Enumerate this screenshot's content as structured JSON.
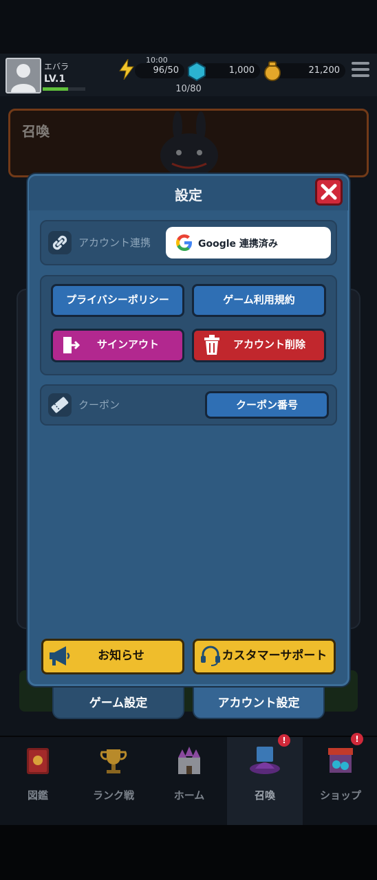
{
  "player": {
    "name": "エバラ",
    "level": "LV.1",
    "xp_progress": 0.6
  },
  "resources": {
    "energy_timer": "10:00",
    "energy": "96/50",
    "gems": "1,000",
    "gold": "21,200",
    "stage_progress": "10/80"
  },
  "background": {
    "summon_title": "召喚"
  },
  "modal": {
    "title": "設定",
    "account_link_label": "アカウント連携",
    "google_button": "Google 連携済み",
    "privacy_button": "プライバシーポリシー",
    "terms_button": "ゲーム利用規約",
    "signout_button": "サインアウト",
    "delete_button": "アカウント削除",
    "coupon_label": "クーポン",
    "coupon_button": "クーポン番号",
    "notice_button": "お知らせ",
    "support_button": "カスタマーサポート",
    "tabs": [
      "ゲーム設定",
      "アカウント設定"
    ],
    "active_tab": "アカウント設定"
  },
  "nav": {
    "items": [
      {
        "label": "図鑑",
        "icon": "book-icon"
      },
      {
        "label": "ランク戦",
        "icon": "trophy-icon"
      },
      {
        "label": "ホーム",
        "icon": "castle-icon"
      },
      {
        "label": "召喚",
        "icon": "summon-hat-icon"
      },
      {
        "label": "ショップ",
        "icon": "shop-icon"
      }
    ],
    "active": "召喚"
  },
  "colors": {
    "modal_bg": "#2f5a80",
    "close_red": "#d0293a",
    "signout_magenta": "#b2288f",
    "delete_red": "#c1272d",
    "button_blue": "#2f6fb4",
    "yellow_button": "#efbd2c"
  }
}
